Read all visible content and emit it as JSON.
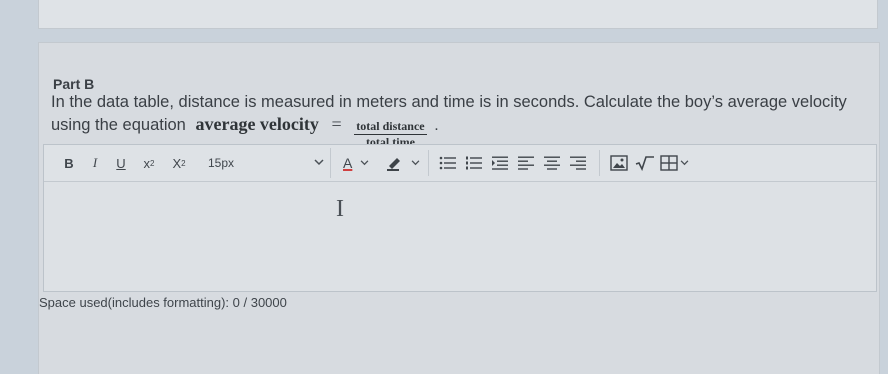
{
  "part_label": "Part B",
  "question": {
    "text": "In the data table, distance is measured in meters and time is in seconds. Calculate the boy’s average velocity using the equation",
    "equation_term": "average velocity",
    "equation_sign": "=",
    "numerator": "total distance",
    "denominator": "total time",
    "period": "."
  },
  "toolbar": {
    "bold": "B",
    "italic": "I",
    "underline": "U",
    "superscript_base": "x",
    "superscript_exp": "2",
    "subscript_base": "X",
    "subscript_sub": "2",
    "font_size": "15px",
    "text_color_letter": "A"
  },
  "status": {
    "space_used": "Space used(includes formatting): 0 / 30000"
  },
  "colors": {
    "text_color_underline": "#d04040"
  }
}
